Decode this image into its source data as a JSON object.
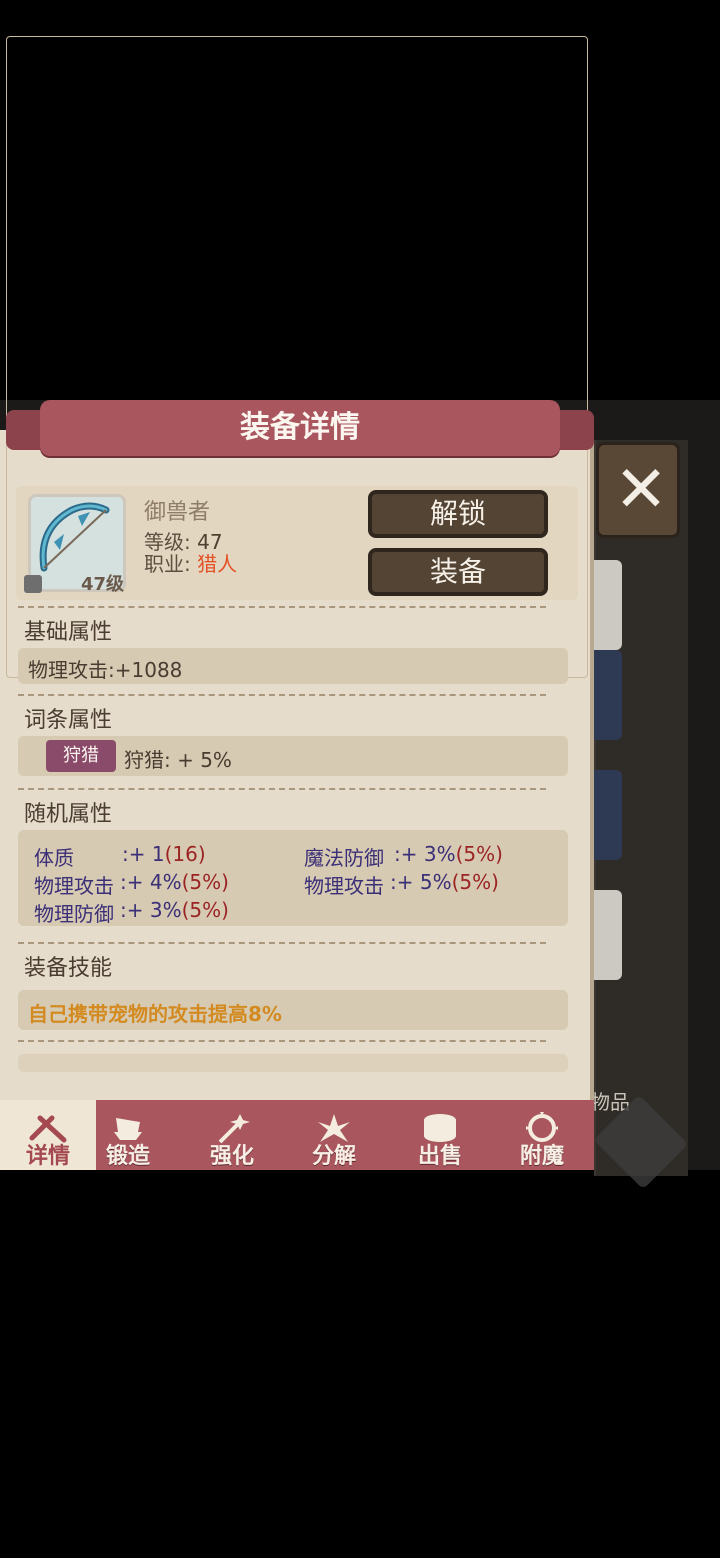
{
  "panel": {
    "title": "装备详情"
  },
  "equipment": {
    "name": "御兽者",
    "level_label": "等级:",
    "level_value": "47",
    "class_label": "职业:",
    "class_value": "猎人",
    "badge_level": "47级"
  },
  "actions": {
    "unlock": "解锁",
    "equip": "装备"
  },
  "sections": {
    "base": {
      "title": "基础属性",
      "value": "物理攻击:+1088"
    },
    "affix": {
      "title": "词条属性",
      "tag": "狩猎",
      "value": "狩猎: + 5%"
    },
    "random": {
      "title": "随机属性",
      "stats": [
        {
          "name": "体质",
          "value": ":+ 1",
          "extra": "(16)"
        },
        {
          "name": "魔法防御",
          "value": ":+ 3%",
          "extra": "(5%)"
        },
        {
          "name": "物理攻击",
          "value": ":+ 4%",
          "extra": "(5%)"
        },
        {
          "name": "物理攻击",
          "value": ":+ 5%",
          "extra": "(5%)"
        },
        {
          "name": "物理防御",
          "value": ":+ 3%",
          "extra": "(5%)"
        }
      ]
    },
    "skill": {
      "title": "装备技能",
      "value": "自己携带宠物的攻击提高8%"
    }
  },
  "background": {
    "item_label": "物品"
  },
  "tabs": [
    "详情",
    "锻造",
    "强化",
    "分解",
    "出售",
    "附魔"
  ]
}
